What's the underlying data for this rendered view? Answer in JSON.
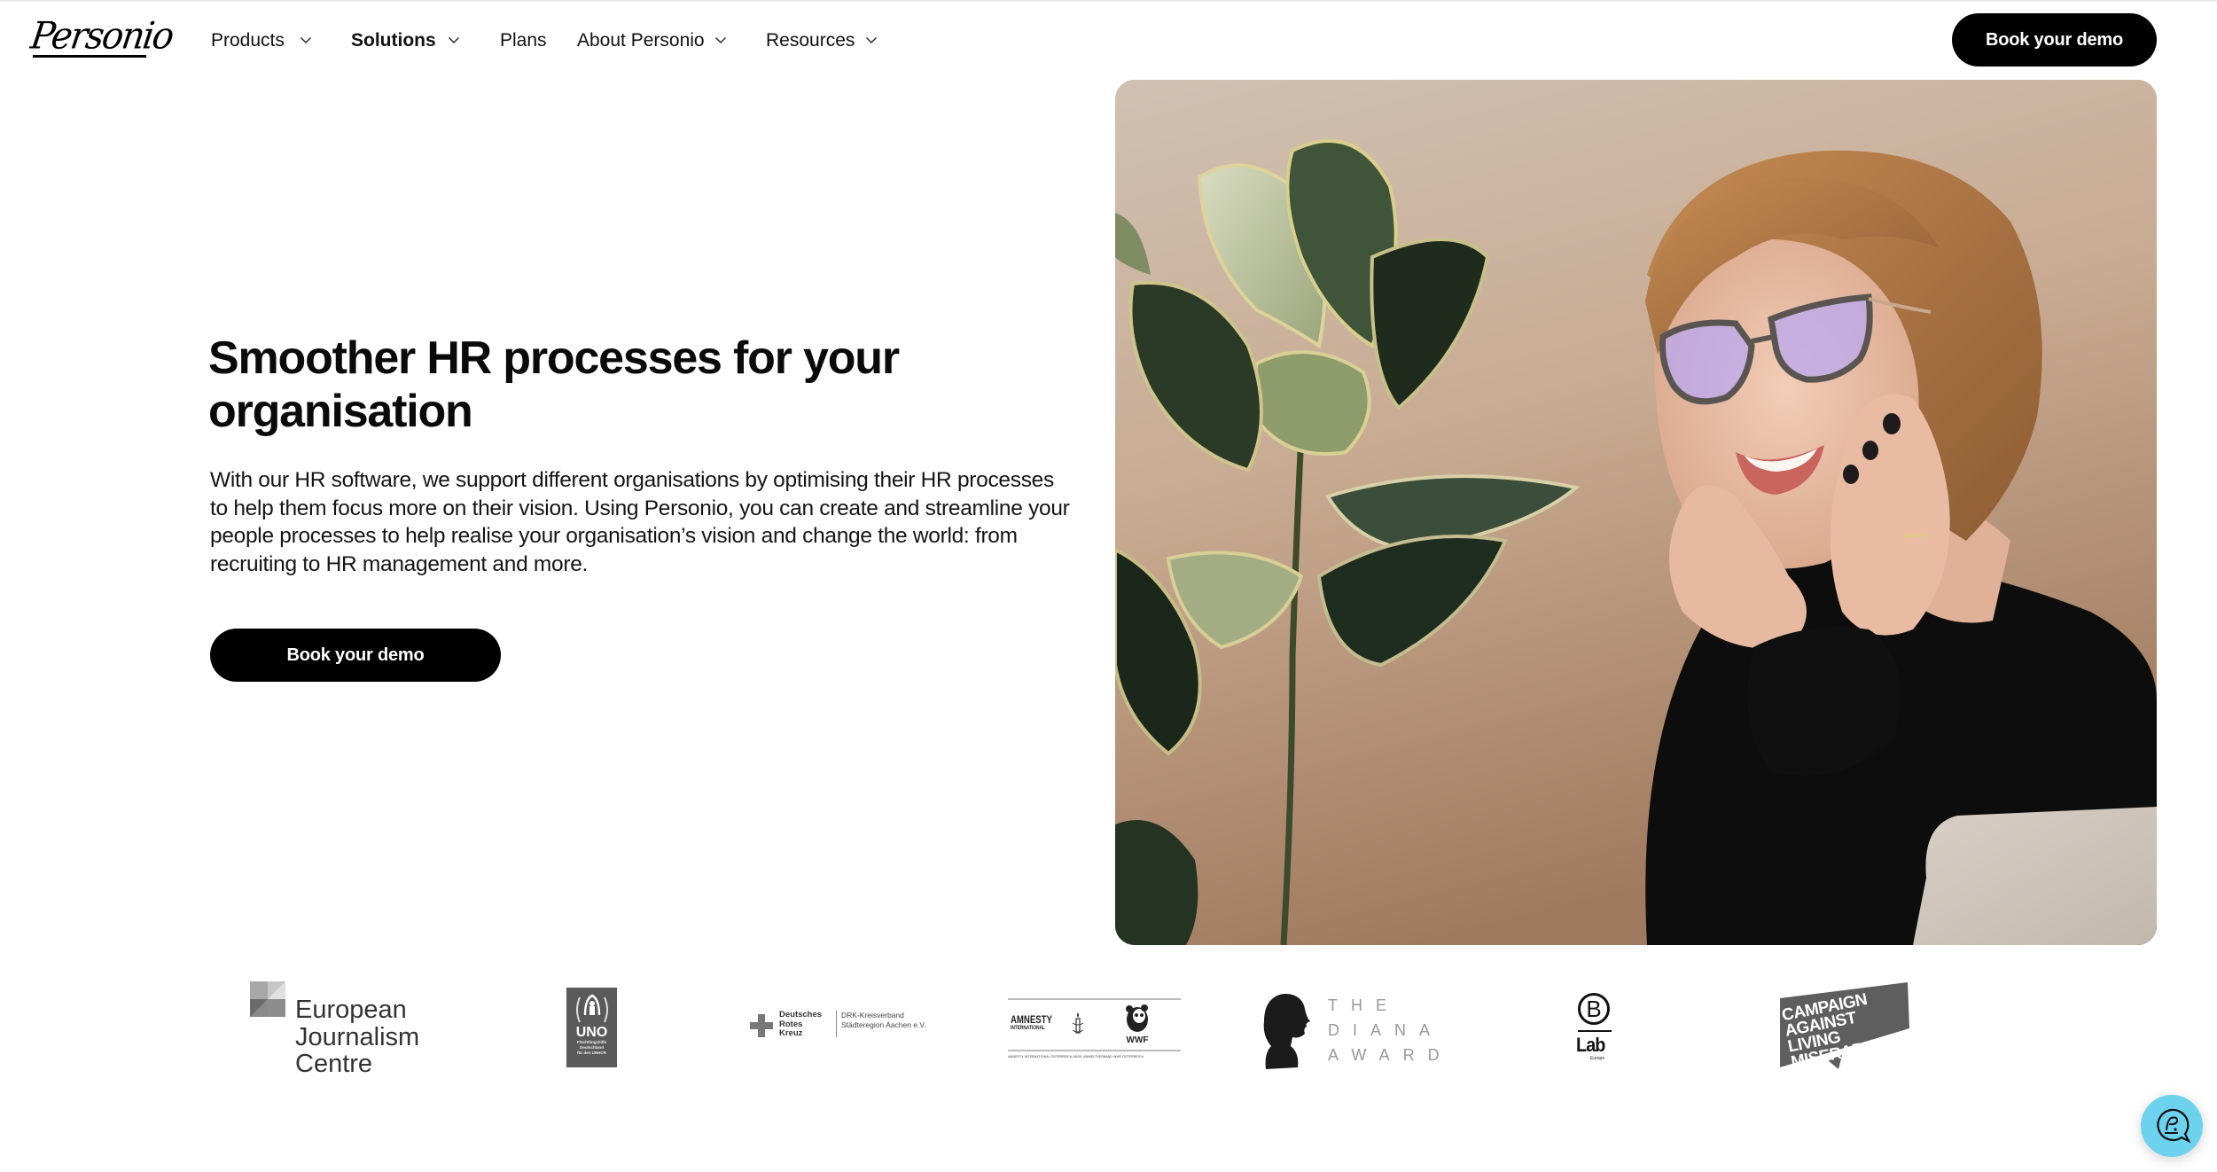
{
  "header": {
    "brand": "Personio",
    "nav": [
      {
        "label": "Products",
        "has_dropdown": true,
        "active": false
      },
      {
        "label": "Solutions",
        "has_dropdown": true,
        "active": true
      },
      {
        "label": "Plans",
        "has_dropdown": false,
        "active": false
      },
      {
        "label": "About Personio",
        "has_dropdown": true,
        "active": false
      },
      {
        "label": "Resources",
        "has_dropdown": true,
        "active": false
      }
    ],
    "cta_label": "Book your demo"
  },
  "hero": {
    "headline": "Smoother HR processes for your organisation",
    "body": "With our HR software, we support different organisations by optimising their HR processes to help them focus more on their vision. Using Personio, you can create and streamline your people processes to help realise your organisation’s vision and change the world: from recruiting to HR management and more.",
    "cta_label": "Book your demo",
    "image_alt": "Smiling woman with glasses resting her face on her hands next to a rubber plant"
  },
  "logos": {
    "ejc": {
      "name": "European Journalism Centre",
      "lines": [
        "European",
        "Journalism",
        "Centre"
      ]
    },
    "uno": {
      "title": "UNO",
      "sub": [
        "Flüchtlingshilfe",
        "Deutschland",
        "für den UNHCR"
      ]
    },
    "drk": {
      "main": [
        "Deutsches",
        "Rotes",
        "Kreuz"
      ],
      "sub": [
        "DRK-Kreisverband",
        "Städteregion Aachen e.V."
      ]
    },
    "amnesty_wwf": {
      "amnesty": "AMNESTY",
      "amnesty_sub": "INTERNATIONAL",
      "wwf": "WWF",
      "footer": "AMNESTY INTERNATIONAL ÖSTERREICH  ARGE  UMWELTVERBAND WWF ÖSTERREICH"
    },
    "diana": {
      "lines": [
        "THE",
        "DIANA",
        "AWARD"
      ]
    },
    "blab": {
      "letter": "B",
      "word": "Lab",
      "region": "Europe"
    },
    "calm": {
      "lines": [
        "CAMPAIGN",
        "AGAINST",
        "LIVING",
        "MISERABLY"
      ]
    }
  },
  "colors": {
    "primary": "#000000",
    "background": "#ffffff",
    "chat_widget": "#6dd2ee",
    "photo_wall": "#c9ad95"
  },
  "chat_widget": {
    "icon": "personio-chat-icon"
  }
}
